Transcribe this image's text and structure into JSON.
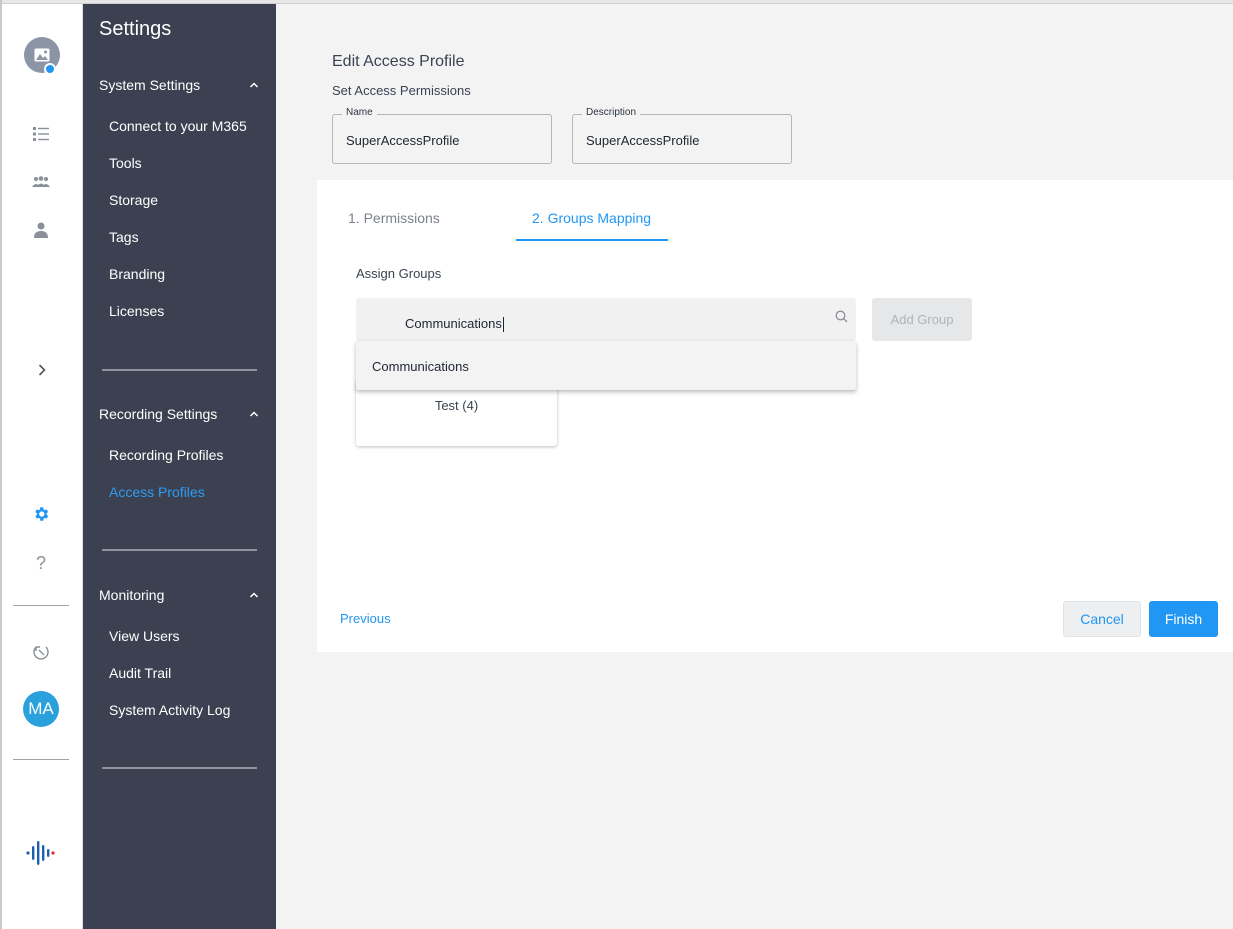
{
  "rail": {
    "avatar_initials": "MA",
    "help_symbol": "?",
    "expand_symbol": "›"
  },
  "sidebar": {
    "title": "Settings",
    "sections": [
      {
        "label": "System Settings",
        "items": [
          "Connect to your M365",
          "Tools",
          "Storage",
          "Tags",
          "Branding",
          "Licenses"
        ]
      },
      {
        "label": "Recording Settings",
        "items": [
          "Recording Profiles",
          "Access Profiles"
        ]
      },
      {
        "label": "Monitoring",
        "items": [
          "View Users",
          "Audit Trail",
          "System Activity Log"
        ]
      }
    ],
    "active_item": "Access Profiles"
  },
  "header": {
    "title": "Edit Access Profile",
    "subtitle": "Set Access Permissions",
    "name_label": "Name",
    "name_value": "SuperAccessProfile",
    "description_label": "Description",
    "description_value": "SuperAccessProfile"
  },
  "tabs": {
    "permissions": "1. Permissions",
    "groups_mapping": "2. Groups Mapping",
    "active": "2. Groups Mapping"
  },
  "groups": {
    "assign_label": "Assign Groups",
    "search_value": "Communications",
    "add_button": "Add Group",
    "dropdown_option": "Communications",
    "assigned": [
      "Test (4)"
    ]
  },
  "footer": {
    "previous": "Previous",
    "cancel": "Cancel",
    "finish": "Finish"
  },
  "colors": {
    "accent": "#2196f3",
    "sidebar_bg": "#3b4150",
    "avatar_bg": "#2aa0dd"
  }
}
